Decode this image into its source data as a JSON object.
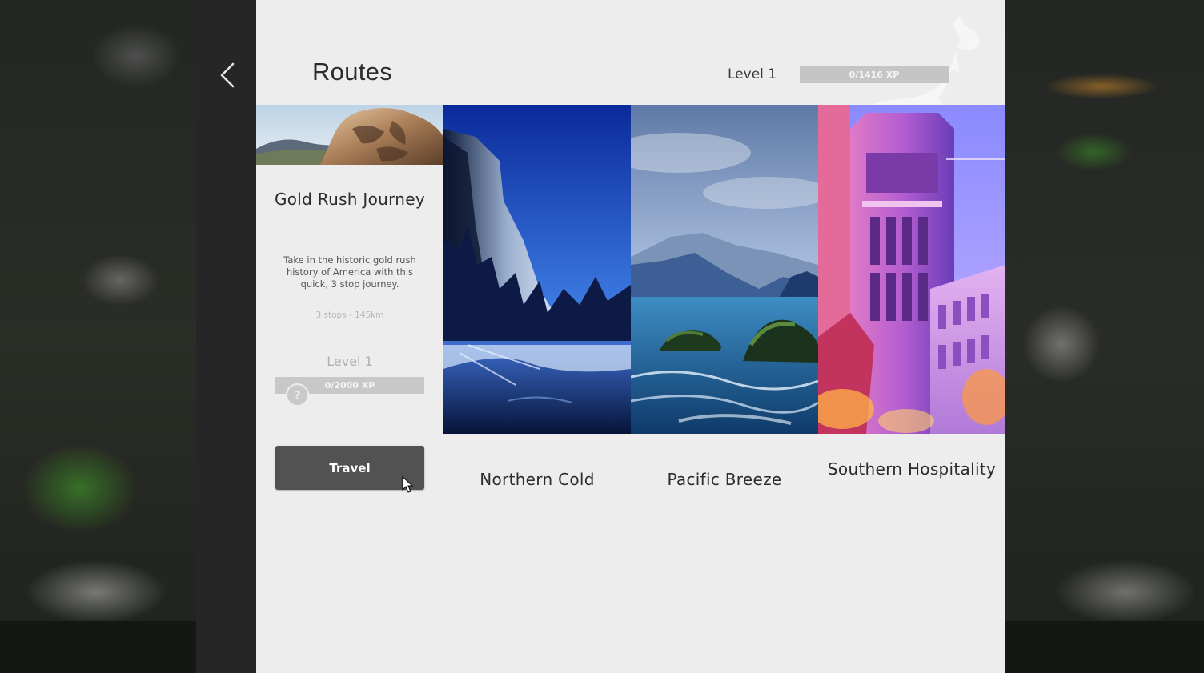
{
  "page": {
    "title": "Routes"
  },
  "player": {
    "level_label": "Level 1",
    "xp_text": "0/1416 XP",
    "xp_progress": 0
  },
  "selected_route": {
    "name": "Gold Rush Journey",
    "description": "Take in the historic gold rush history of America with this quick, 3 stop journey.",
    "stats": "3 stops - 145km",
    "level_label": "Level 1",
    "xp_text": "0/2000 XP",
    "xp_progress": 0,
    "help_label": "?",
    "travel_label": "Travel"
  },
  "routes": [
    {
      "name": "Northern Cold",
      "image": "snowy-cliff-lake"
    },
    {
      "name": "Pacific Breeze",
      "image": "coastal-sea-rocks"
    },
    {
      "name": "Southern Hospitality",
      "image": "city-buildings-night"
    }
  ],
  "icons": {
    "back": "chevron-left-icon",
    "help": "question-icon",
    "watermark": "kangaroo-icon"
  },
  "colors": {
    "panel": "#ededed",
    "button": "#525252",
    "xp_bar": "#c5c5c5"
  }
}
